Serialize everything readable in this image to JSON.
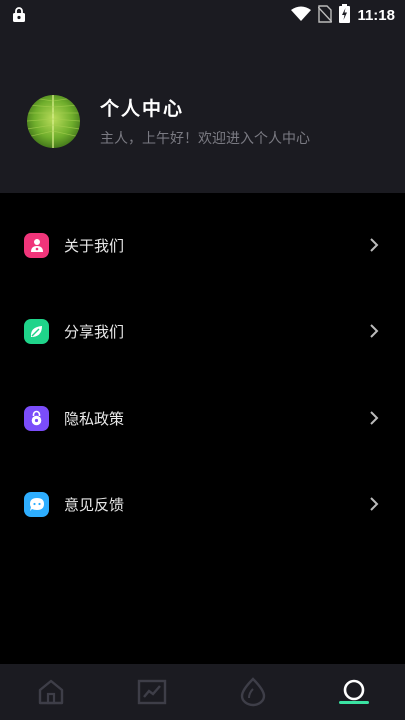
{
  "status_bar": {
    "time": "11:18"
  },
  "profile": {
    "title": "个人中心",
    "subtitle": "主人，上午好！欢迎进入个人中心"
  },
  "menu": [
    {
      "label": "关于我们",
      "icon": "person-badge-icon",
      "color": "#f0357a"
    },
    {
      "label": "分享我们",
      "icon": "leaf-icon",
      "color": "#1fd48a"
    },
    {
      "label": "隐私政策",
      "icon": "lock-badge-icon",
      "color": "#7b4dfa"
    },
    {
      "label": "意见反馈",
      "icon": "chat-bubble-icon",
      "color": "#2eaeff"
    }
  ],
  "tabs": [
    {
      "icon": "home-icon",
      "active": false
    },
    {
      "icon": "chart-icon",
      "active": false
    },
    {
      "icon": "drop-icon",
      "active": false
    },
    {
      "icon": "profile-icon",
      "active": true
    }
  ],
  "colors": {
    "accent": "#3be3a3",
    "header_bg": "#1b1b21",
    "page_bg": "#000000"
  }
}
